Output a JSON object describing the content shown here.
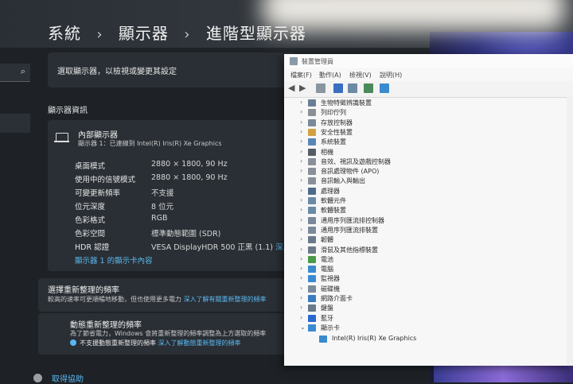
{
  "settings": {
    "breadcrumb": [
      "系統",
      "顯示器",
      "進階型顯示器"
    ],
    "breadcrumb_sep": "›",
    "select_display_label": "選取顯示器，以檢視或變更其設定",
    "section_title": "顯示器資訊",
    "display_name": "內部顯示器",
    "display_sub": "顯示器 1：已連線到 Intel(R) Iris(R) Xe Graphics",
    "specs": [
      {
        "label": "桌面模式",
        "value": "2880 × 1800, 90 Hz"
      },
      {
        "label": "使用中的信號模式",
        "value": "2880 × 1800, 90 Hz"
      },
      {
        "label": "可變更新頻率",
        "value": "不支援"
      },
      {
        "label": "位元深度",
        "value": "8 位元"
      },
      {
        "label": "色彩格式",
        "value": "RGB"
      },
      {
        "label": "色彩空間",
        "value": "標準動態範圍 (SDR)"
      },
      {
        "label": "HDR 認證",
        "value": "VESA DisplayHDR 500 正黑 (1.1)"
      }
    ],
    "hdr_link": "深入了",
    "adapter_link": "顯示器 1 的顯示卡內容",
    "refresh_title": "選擇重新整理的頻率",
    "refresh_desc": "較高的速率可更順暢地移動，但也使用更多電力",
    "refresh_link": "深入了解有關重新整理的頻率",
    "dynamic_title": "動態重新整理的頻率",
    "dynamic_desc": "為了節省電力，Windows 會將重新整理的頻率調整為上方選取的頻率",
    "dynamic_warning": "不支援動態重新整理的頻率",
    "dynamic_link": "深入了解動態重新整理的頻率",
    "help_link": "取得協助"
  },
  "device_manager": {
    "title": "裝置管理員",
    "menu": [
      "檔案(F)",
      "動作(A)",
      "檢視(V)",
      "說明(H)"
    ],
    "nodes": [
      {
        "label": "生物特徵辨識裝置",
        "color": "#6a7f95"
      },
      {
        "label": "列印佇列",
        "color": "#8a8f95"
      },
      {
        "label": "存放控制器",
        "color": "#7a8a9a"
      },
      {
        "label": "安全性裝置",
        "color": "#d0a040"
      },
      {
        "label": "系統裝置",
        "color": "#5a86b6"
      },
      {
        "label": "相機",
        "color": "#555c66"
      },
      {
        "label": "音效、視訊及遊戲控制器",
        "color": "#8a9099"
      },
      {
        "label": "音訊處理物件 (APO)",
        "color": "#8a9099"
      },
      {
        "label": "音訊輸入與輸出",
        "color": "#8a9099"
      },
      {
        "label": "處理器",
        "color": "#4f6b8a"
      },
      {
        "label": "軟體元件",
        "color": "#6a8aa6"
      },
      {
        "label": "軟體裝置",
        "color": "#6a8aa6"
      },
      {
        "label": "通用序列匯流排控制器",
        "color": "#7a8a9a"
      },
      {
        "label": "通用序列匯流排裝置",
        "color": "#7a8a9a"
      },
      {
        "label": "韌體",
        "color": "#6a7a8a"
      },
      {
        "label": "滑鼠及其他指標裝置",
        "color": "#6a7a8a"
      },
      {
        "label": "電池",
        "color": "#4a9a4a"
      },
      {
        "label": "電腦",
        "color": "#3a8ad0"
      },
      {
        "label": "監視器",
        "color": "#3a8ad0"
      },
      {
        "label": "磁碟機",
        "color": "#7a8a9a"
      },
      {
        "label": "網路介面卡",
        "color": "#3a7ac0"
      },
      {
        "label": "鍵盤",
        "color": "#6a7a8a"
      },
      {
        "label": "藍牙",
        "color": "#2a6ad0"
      },
      {
        "label": "顯示卡",
        "color": "#3a8ad0",
        "expanded": true
      }
    ],
    "child": {
      "label": "Intel(R) Iris(R) Xe Graphics",
      "color": "#3a8ad0"
    }
  }
}
